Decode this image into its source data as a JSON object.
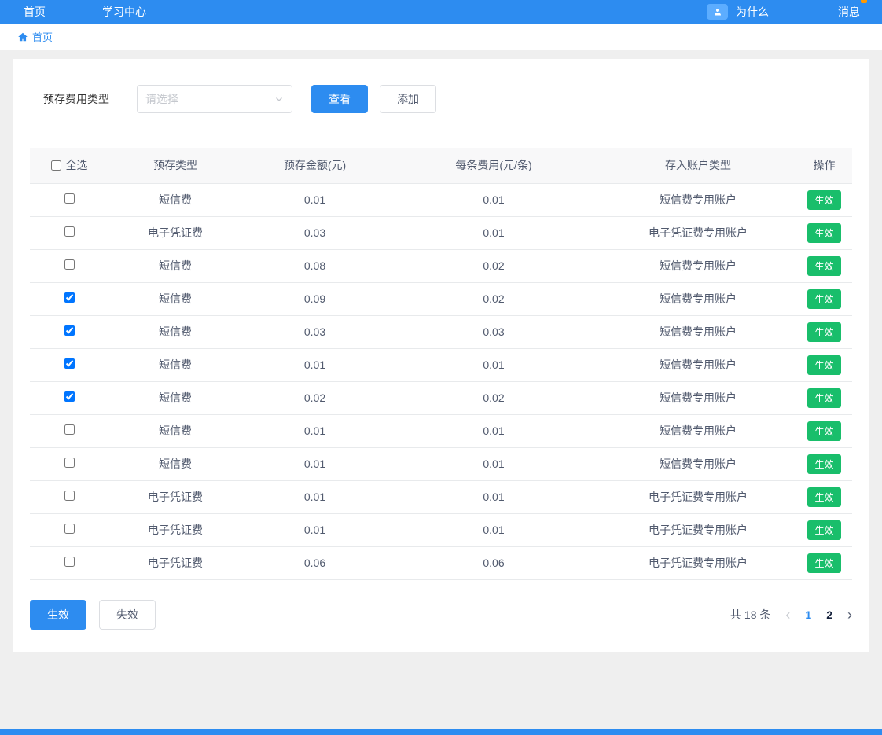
{
  "navbar": {
    "items": [
      {
        "label": "首页"
      },
      {
        "label": "学习中心"
      }
    ],
    "why": "为什么",
    "messages": "消息"
  },
  "breadcrumb": {
    "home": "首页"
  },
  "filter": {
    "label": "预存费用类型",
    "select_placeholder": "请选择",
    "view_button": "查看",
    "add_button": "添加"
  },
  "table": {
    "headers": {
      "select_all": "全选",
      "type": "预存类型",
      "amount": "预存金额(元)",
      "fee": "每条费用(元/条)",
      "account": "存入账户类型",
      "action": "操作"
    },
    "rows": [
      {
        "checked": false,
        "type": "短信费",
        "amount": "0.01",
        "fee": "0.01",
        "account": "短信费专用账户",
        "action": "生效"
      },
      {
        "checked": false,
        "type": "电子凭证费",
        "amount": "0.03",
        "fee": "0.01",
        "account": "电子凭证费专用账户",
        "action": "生效"
      },
      {
        "checked": false,
        "type": "短信费",
        "amount": "0.08",
        "fee": "0.02",
        "account": "短信费专用账户",
        "action": "生效"
      },
      {
        "checked": true,
        "type": "短信费",
        "amount": "0.09",
        "fee": "0.02",
        "account": "短信费专用账户",
        "action": "生效"
      },
      {
        "checked": true,
        "type": "短信费",
        "amount": "0.03",
        "fee": "0.03",
        "account": "短信费专用账户",
        "action": "生效"
      },
      {
        "checked": true,
        "type": "短信费",
        "amount": "0.01",
        "fee": "0.01",
        "account": "短信费专用账户",
        "action": "生效"
      },
      {
        "checked": true,
        "type": "短信费",
        "amount": "0.02",
        "fee": "0.02",
        "account": "短信费专用账户",
        "action": "生效"
      },
      {
        "checked": false,
        "type": "短信费",
        "amount": "0.01",
        "fee": "0.01",
        "account": "短信费专用账户",
        "action": "生效"
      },
      {
        "checked": false,
        "type": "短信费",
        "amount": "0.01",
        "fee": "0.01",
        "account": "短信费专用账户",
        "action": "生效"
      },
      {
        "checked": false,
        "type": "电子凭证费",
        "amount": "0.01",
        "fee": "0.01",
        "account": "电子凭证费专用账户",
        "action": "生效"
      },
      {
        "checked": false,
        "type": "电子凭证费",
        "amount": "0.01",
        "fee": "0.01",
        "account": "电子凭证费专用账户",
        "action": "生效"
      },
      {
        "checked": false,
        "type": "电子凭证费",
        "amount": "0.06",
        "fee": "0.06",
        "account": "电子凭证费专用账户",
        "action": "生效"
      }
    ]
  },
  "actions": {
    "effective": "生效",
    "invalid": "失效"
  },
  "pagination": {
    "total": "共 18 条",
    "prev": "‹",
    "next": "›",
    "pages": [
      "1",
      "2"
    ],
    "current": "1"
  },
  "colors": {
    "primary": "#2d8cf0",
    "success": "#19be6b",
    "badge": "#ff9900"
  }
}
